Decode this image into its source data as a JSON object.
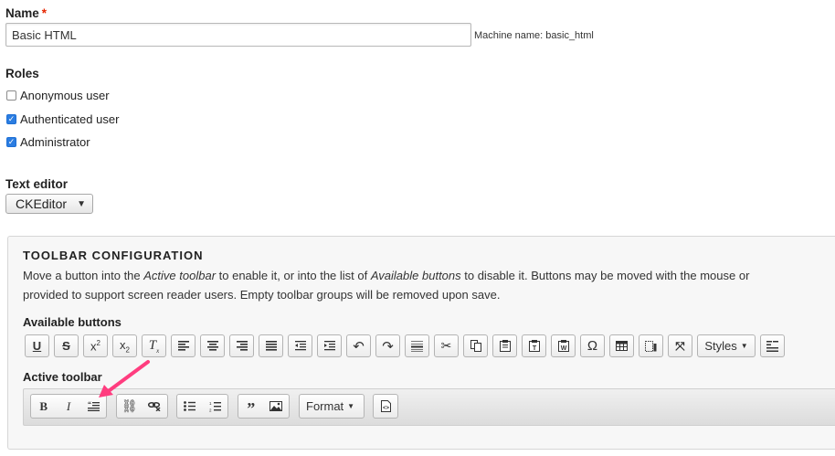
{
  "name_field": {
    "label": "Name",
    "required_mark": "*",
    "value": "Basic HTML",
    "machine_name": "Machine name: basic_html"
  },
  "roles": {
    "label": "Roles",
    "items": [
      {
        "label": "Anonymous user",
        "checked": false
      },
      {
        "label": "Authenticated user",
        "checked": true
      },
      {
        "label": "Administrator",
        "checked": true
      }
    ]
  },
  "text_editor": {
    "label": "Text editor",
    "selected": "CKEditor"
  },
  "toolbar_config": {
    "title": "TOOLBAR CONFIGURATION",
    "description_line1": "Move a button into the Active toolbar to enable it, or into the list of Available buttons to disable it. Buttons may be moved with the mouse or",
    "description_line2": "provided to support screen reader users. Empty toolbar groups will be removed upon save.",
    "available_label": "Available buttons",
    "active_label": "Active toolbar",
    "styles_label": "Styles",
    "format_label": "Format",
    "accent_color": "#ff3d7f"
  }
}
